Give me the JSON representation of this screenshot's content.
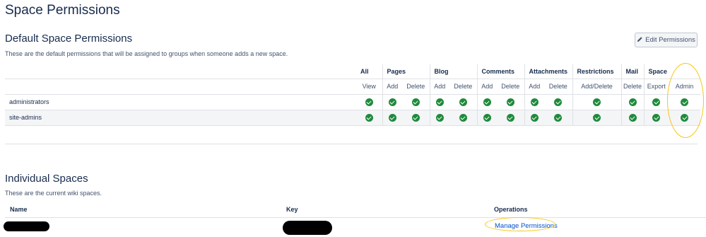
{
  "page": {
    "title": "Space Permissions"
  },
  "default": {
    "title": "Default Space Permissions",
    "description": "These are the default permissions that will be assigned to groups when someone adds a new space.",
    "edit_button": "Edit Permissions",
    "groups": [
      {
        "label": "All",
        "span": 1
      },
      {
        "label": "Pages",
        "span": 2
      },
      {
        "label": "Blog",
        "span": 2
      },
      {
        "label": "Comments",
        "span": 2
      },
      {
        "label": "Attachments",
        "span": 2
      },
      {
        "label": "Restrictions",
        "span": 1
      },
      {
        "label": "Mail",
        "span": 1
      },
      {
        "label": "Space",
        "span": 1
      }
    ],
    "columns": [
      "View",
      "Add",
      "Delete",
      "Add",
      "Delete",
      "Add",
      "Delete",
      "Add",
      "Delete",
      "Add/Delete",
      "Delete",
      "Export",
      "Admin"
    ],
    "rows": [
      {
        "name": "administrators",
        "values": [
          true,
          true,
          true,
          true,
          true,
          true,
          true,
          true,
          true,
          true,
          true,
          true,
          true
        ]
      },
      {
        "name": "site-admins",
        "values": [
          true,
          true,
          true,
          true,
          true,
          true,
          true,
          true,
          true,
          true,
          true,
          true,
          true
        ]
      }
    ],
    "check_icon": "check-circle-icon",
    "check_color": "#1e8a3c"
  },
  "individual": {
    "title": "Individual Spaces",
    "description": "These are the current wiki spaces.",
    "headers": {
      "name": "Name",
      "key": "Key",
      "operations": "Operations"
    },
    "row": {
      "operation": "Manage Permissions"
    }
  },
  "colors": {
    "link": "#0052cc",
    "highlight": "#f5c518"
  }
}
